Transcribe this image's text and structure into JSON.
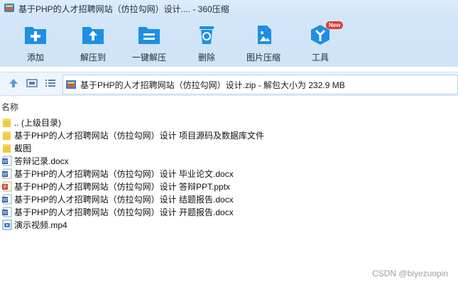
{
  "window": {
    "title": "基于PHP的人才招聘网站（仿拉勾网）设计.... - 360压缩"
  },
  "toolbar": {
    "buttons": [
      {
        "label": "添加",
        "icon": "add-icon"
      },
      {
        "label": "解压到",
        "icon": "extract-to-icon"
      },
      {
        "label": "一键解压",
        "icon": "one-click-extract-icon"
      },
      {
        "label": "删除",
        "icon": "trash-icon"
      },
      {
        "label": "图片压缩",
        "icon": "image-compress-icon"
      },
      {
        "label": "工具",
        "icon": "tools-icon",
        "badge": "New"
      }
    ]
  },
  "nav": {
    "path": "基于PHP的人才招聘网站（仿拉勾网）设计.zip - 解包大小为 232.9 MB"
  },
  "list": {
    "column_name": "名称",
    "items": [
      {
        "name": ".. (上级目录)",
        "type": "folder"
      },
      {
        "name": "基于PHP的人才招聘网站（仿拉勾网）设计 项目源码及数据库文件",
        "type": "folder"
      },
      {
        "name": "截图",
        "type": "folder"
      },
      {
        "name": "答辩记录.docx",
        "type": "docx"
      },
      {
        "name": "基于PHP的人才招聘网站（仿拉勾网）设计 毕业论文.docx",
        "type": "docx"
      },
      {
        "name": "基于PHP的人才招聘网站（仿拉勾网）设计 答辩PPT.pptx",
        "type": "pptx"
      },
      {
        "name": "基于PHP的人才招聘网站（仿拉勾网）设计 结题报告.docx",
        "type": "docx"
      },
      {
        "name": "基于PHP的人才招聘网站（仿拉勾网）设计 开题报告.docx",
        "type": "docx"
      },
      {
        "name": "演示视频.mp4",
        "type": "video"
      }
    ]
  },
  "watermark": "CSDN @biyezuopin",
  "colors": {
    "accent": "#1e8fe1",
    "toolbar_bg": "#d3e6f8",
    "folder": "#f5c842"
  }
}
